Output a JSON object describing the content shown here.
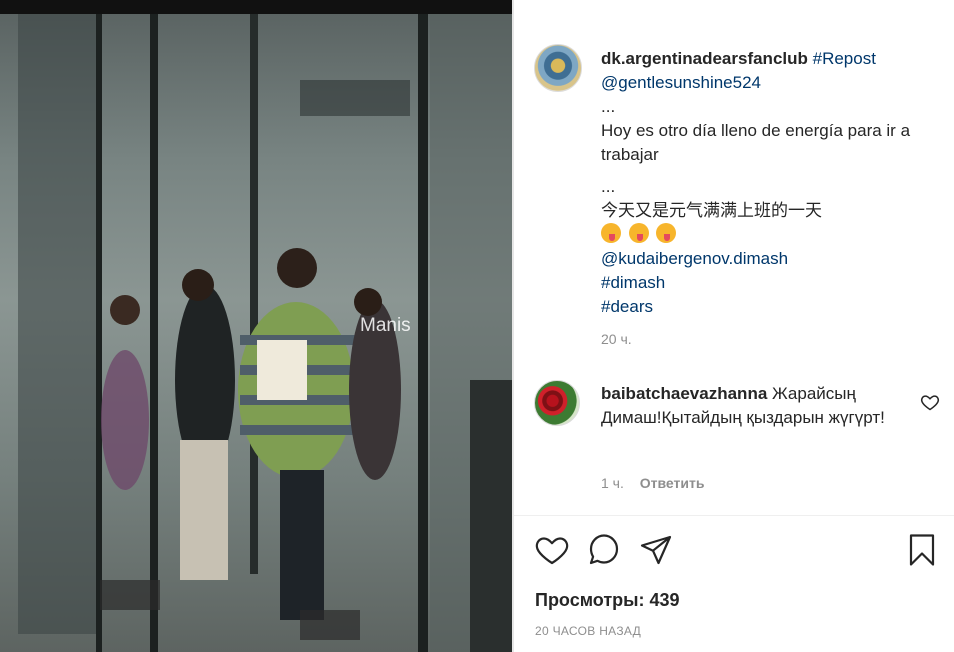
{
  "post": {
    "username": "dk.argentinadearsfanclub",
    "repost_tag": "#Repost",
    "repost_user": "@gentlesunshine524",
    "ellipsis1": "...",
    "spanish": "Hoy es otro día lleno de energía para ir a trabajar",
    "ellipsis2": "...",
    "chinese": "今天又是元气满满上班的一天",
    "mention": "@kudaibergenov.dimash",
    "tag1": "#dimash",
    "tag2": "#dears",
    "time": "20 ч."
  },
  "comment": {
    "username": "baibatchaevazhanna",
    "text": "Жарайсың Димаш!Қытайдың қыздарын жүгүрт!",
    "time": "1 ч.",
    "reply": "Ответить"
  },
  "footer": {
    "views_label": "Просмотры:",
    "views_count": "439",
    "timestamp": "20 ЧАСОВ НАЗАД"
  },
  "media": {
    "watermark": "Manis"
  },
  "icons": {
    "like": "heart-icon",
    "comment": "comment-icon",
    "share": "paper-plane-icon",
    "save": "bookmark-icon",
    "comment_like": "heart-icon"
  }
}
